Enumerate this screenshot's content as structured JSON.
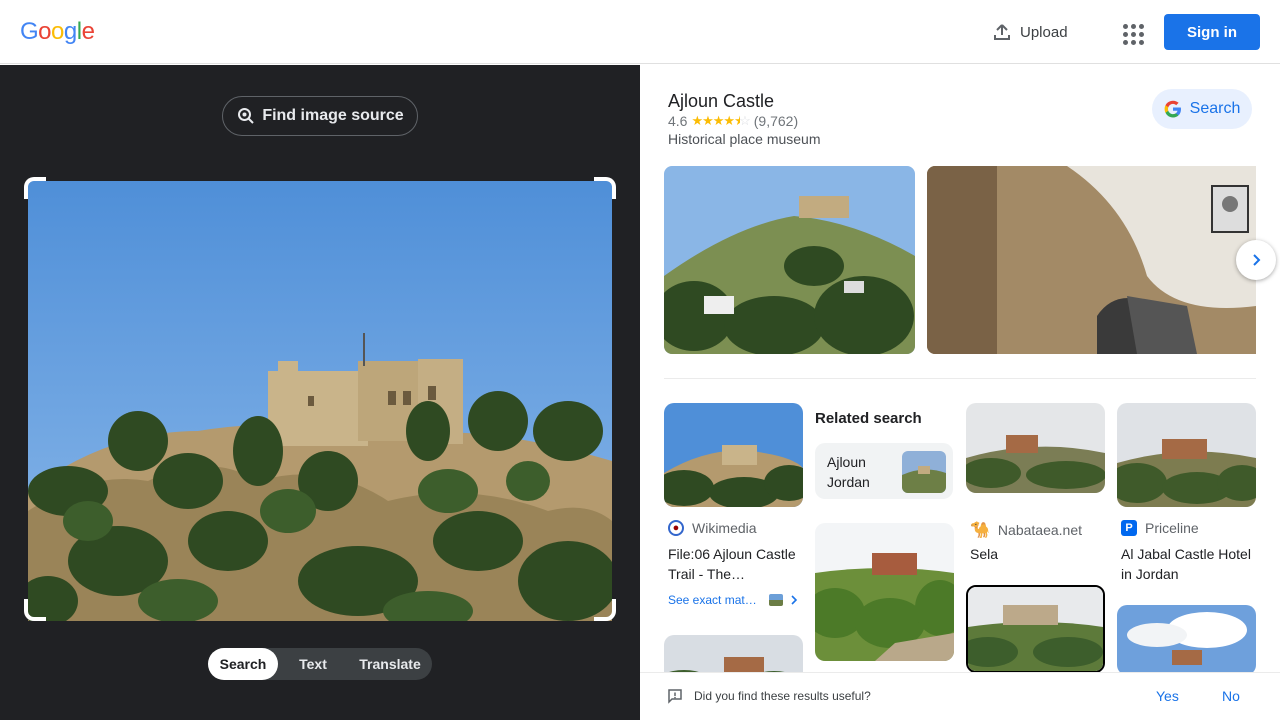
{
  "header": {
    "logo": [
      "G",
      "o",
      "o",
      "g",
      "l",
      "e"
    ],
    "logo_colors": [
      "#4285F4",
      "#EA4335",
      "#FBBC05",
      "#4285F4",
      "#34A853",
      "#EA4335"
    ],
    "upload_label": "Upload",
    "signin_label": "Sign in"
  },
  "left_panel": {
    "find_source_label": "Find image source",
    "modes": [
      "Search",
      "Text",
      "Translate"
    ],
    "active_mode": "Search"
  },
  "knowledge_panel": {
    "title": "Ajloun Castle",
    "rating": "4.6",
    "rating_stars": 4.6,
    "review_count": "(9,762)",
    "subtitle": "Historical place museum",
    "search_button": "Search"
  },
  "results": {
    "related_heading": "Related search",
    "related_chip": "Ajloun Jordan",
    "cards": [
      {
        "source": "Wikimedia",
        "title": "File:06 Ajloun Castle Trail - The…",
        "exact_link": "See exact mat…"
      },
      {
        "source": "Nabataea.net",
        "title": "Sela"
      },
      {
        "source": "Priceline",
        "title": "Al Jabal Castle Hotel in Jordan"
      }
    ]
  },
  "feedback": {
    "question": "Did you find these results useful?",
    "yes": "Yes",
    "no": "No"
  },
  "colors": {
    "accent": "#1a73e8",
    "dark_panel": "#202124",
    "star": "#fbbc04"
  }
}
